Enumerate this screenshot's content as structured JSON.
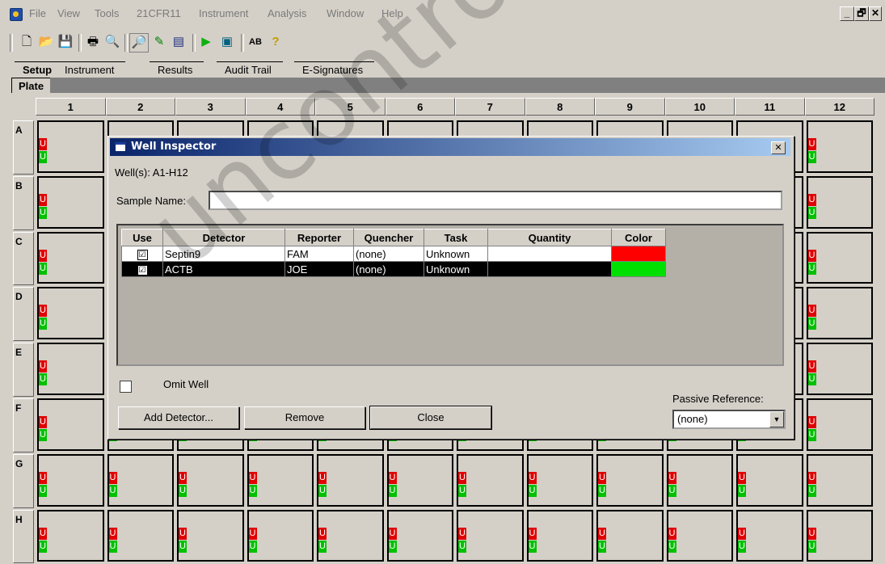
{
  "menu": [
    "File",
    "View",
    "Tools",
    "21CFR11",
    "Instrument",
    "Analysis",
    "Window",
    "Help"
  ],
  "window_controls": {
    "minimize": "_",
    "restore": "🗗",
    "close": "✕"
  },
  "toolbar_icons": [
    "new-document-icon",
    "open-folder-icon",
    "save-icon",
    "print-icon",
    "print-preview-icon",
    "inspect-icon",
    "edit-icon",
    "plate-layout-icon",
    "run-icon",
    "analyze-icon",
    "spelling-icon",
    "help-icon"
  ],
  "tabs": [
    "Setup",
    "Instrument",
    "Results",
    "Audit Trail",
    "E-Signatures"
  ],
  "subtab": "Plate",
  "plate": {
    "columns": [
      "1",
      "2",
      "3",
      "4",
      "5",
      "6",
      "7",
      "8",
      "9",
      "10",
      "11",
      "12"
    ],
    "rows": [
      "A",
      "B",
      "C",
      "D",
      "E",
      "F",
      "G",
      "H"
    ],
    "well_marker_red": "U",
    "well_marker_green": "U"
  },
  "dialog": {
    "title": "Well Inspector",
    "close_label": "✕",
    "wells_label": "Well(s): A1-H12",
    "sample_name_label": "Sample Name:",
    "sample_name_value": "",
    "table": {
      "headers": [
        "Use",
        "Detector",
        "Reporter",
        "Quencher",
        "Task",
        "Quantity",
        "Color"
      ],
      "rows": [
        {
          "use": "☑",
          "detector": "Septin9",
          "reporter": "FAM",
          "quencher": "(none)",
          "task": "Unknown",
          "quantity": "",
          "color": "#ff0000"
        },
        {
          "use": "☑",
          "detector": "ACTB",
          "reporter": "JOE",
          "quencher": "(none)",
          "task": "Unknown",
          "quantity": "",
          "color": "#00e000"
        }
      ]
    },
    "omit_well_label": "Omit Well",
    "passive_reference_label": "Passive Reference:",
    "passive_reference_value": "(none)",
    "buttons": {
      "add_detector": "Add Detector...",
      "remove": "Remove",
      "close": "Close"
    }
  },
  "watermark": "uncontrolled"
}
